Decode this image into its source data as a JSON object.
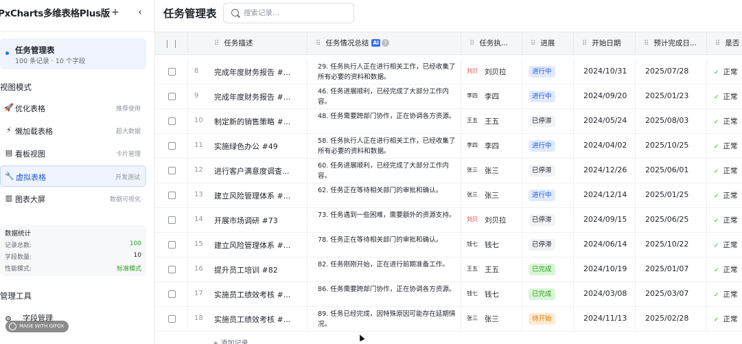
{
  "sidebar": {
    "app_title": "PxCharts多维表格Plus版",
    "add_icon": "plus-icon",
    "collapse_icon": "chevron-left-icon",
    "current_table": {
      "name": "任务管理表",
      "meta": "100 条记录 · 10 个字段"
    },
    "view_mode_title": "视图模式",
    "modes": [
      {
        "icon": "rocket-icon",
        "glyph": "🚀",
        "label": "优化表格",
        "tag": "推荐使用",
        "active": false
      },
      {
        "icon": "lightning-icon",
        "glyph": "⚡",
        "label": "懒加载表格",
        "tag": "超大数据",
        "active": false
      },
      {
        "icon": "kanban-icon",
        "glyph": "▤",
        "label": "看板视图",
        "tag": "卡片管理",
        "active": false
      },
      {
        "icon": "wrench-icon",
        "glyph": "🔧",
        "label": "虚拟表格",
        "tag": "开发测试",
        "active": true
      },
      {
        "icon": "chart-icon",
        "glyph": "▥",
        "label": "图表大屏",
        "tag": "数据可视化",
        "active": false
      }
    ],
    "stats": {
      "title": "数据统计",
      "rows": [
        {
          "label": "记录总数:",
          "value": "100",
          "green": true
        },
        {
          "label": "字段数量:",
          "value": "10",
          "green": false
        },
        {
          "label": "性能模式:",
          "value": "标准模式",
          "green": true
        }
      ]
    },
    "tools_title": "管理工具",
    "tools": [
      {
        "icon": "gear-icon",
        "label": "字段管理"
      }
    ],
    "watermark": "MADE WITH GIFOX"
  },
  "header": {
    "title": "任务管理表",
    "search_placeholder": "搜索记录..."
  },
  "columns": [
    {
      "key": "check",
      "label": ""
    },
    {
      "key": "desc",
      "label": "任务描述"
    },
    {
      "key": "summary",
      "label": "任务情况总结",
      "ai": "AI",
      "help": "?"
    },
    {
      "key": "owner",
      "label": "任务执..."
    },
    {
      "key": "status",
      "label": "进展"
    },
    {
      "key": "start",
      "label": "开始日期"
    },
    {
      "key": "due",
      "label": "预计完成日..."
    },
    {
      "key": "ok",
      "label": "是否"
    }
  ],
  "status_colors": {
    "进行中": {
      "bg": "#e1eaff",
      "fg": "#245bdb"
    },
    "已停滞": {
      "bg": "#f2f3f5",
      "fg": "#1f2329"
    },
    "已完成": {
      "bg": "#d9f5d6",
      "fg": "#2ea121"
    },
    "待开始": {
      "bg": "#feead2",
      "fg": "#de7802"
    }
  },
  "rows": [
    {
      "num": "8",
      "desc": "完成年度财务报告 #...",
      "summary": "29. 任务执行人正在进行相关工作，已经收集了所有必要的资料和数据。",
      "avatar": "刘贝",
      "avatar_red": true,
      "owner": "刘贝拉",
      "status": "进行中",
      "start": "2024/10/31",
      "due": "2025/07/28",
      "ok": "正常"
    },
    {
      "num": "9",
      "desc": "完成年度财务报告 #...",
      "summary": "46. 任务进展顺利，已经完成了大部分工作内容。",
      "avatar": "李四",
      "avatar_red": false,
      "owner": "李四",
      "status": "进行中",
      "start": "2024/09/20",
      "due": "2025/01/23",
      "ok": "正常"
    },
    {
      "num": "10",
      "desc": "制定新的销售策略 #...",
      "summary": "48. 任务需要跨部门协作，正在协调各方资源。",
      "avatar": "王五",
      "avatar_red": false,
      "owner": "王五",
      "status": "已停滞",
      "start": "2024/05/24",
      "due": "2025/08/03",
      "ok": "正常"
    },
    {
      "num": "11",
      "desc": "实施绿色办公 #49",
      "summary": "58. 任务执行人正在进行相关工作，已经收集了所有必要的资料和数据。",
      "avatar": "李四",
      "avatar_red": false,
      "owner": "李四",
      "status": "进行中",
      "start": "2024/04/02",
      "due": "2025/10/25",
      "ok": "正常"
    },
    {
      "num": "12",
      "desc": "进行客户满意度调查...",
      "summary": "60. 任务进展顺利，已经完成了大部分工作内容。",
      "avatar": "张三",
      "avatar_red": false,
      "owner": "张三",
      "status": "已停滞",
      "start": "2024/12/26",
      "due": "2025/06/01",
      "ok": "正常"
    },
    {
      "num": "13",
      "desc": "建立风险管理体系 #...",
      "summary": "62. 任务正在等待相关部门的审批和确认。",
      "avatar": "张三",
      "avatar_red": false,
      "owner": "张三",
      "status": "进行中",
      "start": "2024/12/14",
      "due": "2025/01/25",
      "ok": "正常"
    },
    {
      "num": "14",
      "desc": "开展市场调研 #73",
      "summary": "73. 任务遇到一些困难，需要额外的资源支持。",
      "avatar": "刘贝",
      "avatar_red": true,
      "owner": "刘贝拉",
      "status": "已停滞",
      "start": "2024/09/15",
      "due": "2025/06/25",
      "ok": "正常"
    },
    {
      "num": "15",
      "desc": "建立风险管理体系 #...",
      "summary": "78. 任务正在等待相关部门的审批和确认。",
      "avatar": "钱七",
      "avatar_red": false,
      "owner": "钱七",
      "status": "已停滞",
      "start": "2024/06/14",
      "due": "2025/10/22",
      "ok": "正常"
    },
    {
      "num": "16",
      "desc": "提升员工培训 #82",
      "summary": "82. 任务刚刚开始，正在进行前期准备工作。",
      "avatar": "王五",
      "avatar_red": false,
      "owner": "王五",
      "status": "已完成",
      "start": "2024/10/19",
      "due": "2025/01/07",
      "ok": "正常"
    },
    {
      "num": "17",
      "desc": "实施员工绩效考核 #...",
      "summary": "86. 任务需要跨部门协作，正在协调各方资源。",
      "avatar": "钱七",
      "avatar_red": false,
      "owner": "钱七",
      "status": "已完成",
      "start": "2024/03/08",
      "due": "2025/03/07",
      "ok": "正常"
    },
    {
      "num": "18",
      "desc": "实施员工绩效考核 #...",
      "summary": "89. 任务已经完成，因特殊原因可能存在延期情况。",
      "avatar": "张三",
      "avatar_red": false,
      "owner": "张三",
      "status": "待开始",
      "start": "2024/11/13",
      "due": "2025/02/28",
      "ok": "正常"
    }
  ],
  "add_record_label": "+ 添加记录"
}
